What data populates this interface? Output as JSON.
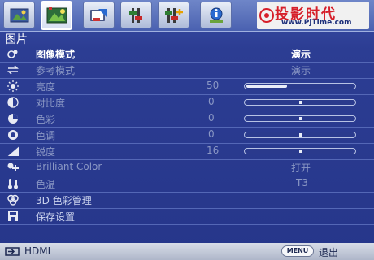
{
  "watermark": {
    "title": "投影时代",
    "url": "www.PjTime.com"
  },
  "tabs": [
    {
      "icon": "picture-tab-icon",
      "active": false
    },
    {
      "icon": "advanced-picture-tab-icon",
      "active": true
    },
    {
      "icon": "display-tab-icon",
      "active": false
    },
    {
      "icon": "settings-basic-tab-icon",
      "active": false
    },
    {
      "icon": "settings-advanced-tab-icon",
      "active": false
    },
    {
      "icon": "information-tab-icon",
      "active": false
    }
  ],
  "section_title": "图片",
  "rows": [
    {
      "key": "picture-mode",
      "label": "图像模式",
      "value": "演示",
      "icon": "picture-mode-icon",
      "state": "on"
    },
    {
      "key": "reference-mode",
      "label": "参考模式",
      "value": "演示",
      "icon": "reference-mode-icon",
      "state": "off"
    },
    {
      "key": "brightness",
      "label": "亮度",
      "value": "50",
      "icon": "brightness-icon",
      "state": "off",
      "slider": 0.5
    },
    {
      "key": "contrast",
      "label": "对比度",
      "value": "0",
      "icon": "contrast-icon",
      "state": "off",
      "slider": 0.5
    },
    {
      "key": "color",
      "label": "色彩",
      "value": "0",
      "icon": "color-icon",
      "state": "off",
      "slider": 0.5
    },
    {
      "key": "tint",
      "label": "色调",
      "value": "0",
      "icon": "tint-icon",
      "state": "off",
      "slider": 0.5
    },
    {
      "key": "sharpness",
      "label": "锐度",
      "value": "16",
      "icon": "sharpness-icon",
      "state": "off",
      "slider": 0.5
    },
    {
      "key": "brilliant-color",
      "label": "Brilliant Color",
      "value": "打开",
      "icon": "brilliant-color-icon",
      "state": "off"
    },
    {
      "key": "color-temperature",
      "label": "色温",
      "value": "T3",
      "icon": "color-temperature-icon",
      "state": "off"
    },
    {
      "key": "3d-color-management",
      "label": "3D 色彩管理",
      "value": "",
      "icon": "3d-color-icon",
      "state": "dim"
    },
    {
      "key": "save-settings",
      "label": "保存设置",
      "value": "",
      "icon": "save-icon",
      "state": "dim"
    }
  ],
  "bottom": {
    "source": "HDMI",
    "menu_key": "MENU",
    "exit": "退出"
  },
  "colors": {
    "accent_red": "#d61f2a",
    "menu_bg": "#2c3d93",
    "text_on": "#ffffff",
    "text_off": "#8a97c4"
  }
}
